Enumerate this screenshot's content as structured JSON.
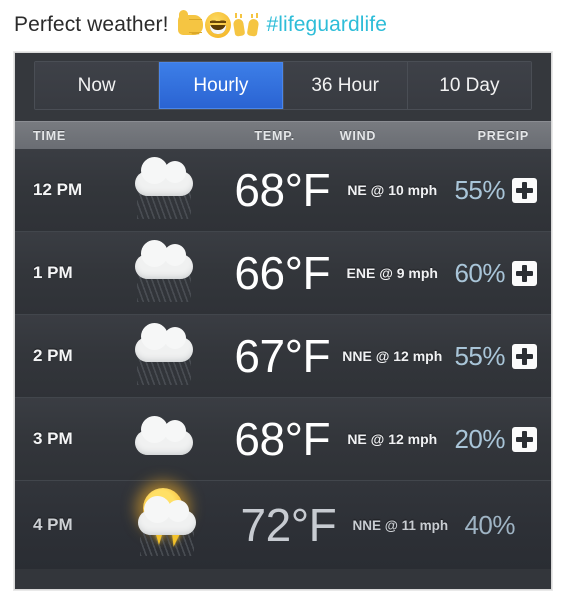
{
  "caption": {
    "text": "Perfect weather!",
    "emoji": [
      "thumbs-up",
      "grinning-face",
      "raised-hands"
    ],
    "hashtag": "#lifeguardlife",
    "hashtag_color": "#2ebdd8"
  },
  "panel": {
    "tabs": [
      {
        "label": "Now",
        "active": false
      },
      {
        "label": "Hourly",
        "active": true
      },
      {
        "label": "36 Hour",
        "active": false
      },
      {
        "label": "10 Day",
        "active": false
      }
    ],
    "active_tab_color": "#2f6fdb",
    "columns": [
      "TIME",
      "TEMP.",
      "WIND",
      "PRECIP"
    ],
    "rows": [
      {
        "time": "12 PM",
        "icon": "rain-cloud-icon",
        "temp": "68°F",
        "wind": "NE @ 10 mph",
        "precip": "55%",
        "expand": "+"
      },
      {
        "time": "1 PM",
        "icon": "rain-cloud-icon",
        "temp": "66°F",
        "wind": "ENE @ 9 mph",
        "precip": "60%",
        "expand": "+"
      },
      {
        "time": "2 PM",
        "icon": "rain-cloud-icon",
        "temp": "67°F",
        "wind": "NNE @ 12 mph",
        "precip": "55%",
        "expand": "+"
      },
      {
        "time": "3 PM",
        "icon": "cloudy-icon",
        "temp": "68°F",
        "wind": "NE @ 12 mph",
        "precip": "20%",
        "expand": "+"
      },
      {
        "time": "4 PM",
        "icon": "sun-thunderstorm-icon",
        "temp": "72°F",
        "wind": "NNE @ 11 mph",
        "precip": "40%",
        "expand": null
      }
    ],
    "precip_text_color": "#a9c5d8",
    "background_color": "#33363b"
  }
}
